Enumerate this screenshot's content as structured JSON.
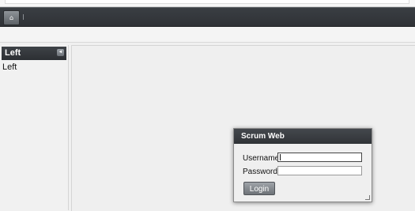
{
  "toolbar": {
    "home_icon": "home-icon",
    "home_glyph": "⌂"
  },
  "left_panel": {
    "header_title": "Left",
    "collapse_icon": "chevron-left-icon",
    "collapse_glyph": "◂",
    "body_text": "Left"
  },
  "login_dialog": {
    "title": "Scrum Web",
    "username_label": "Username",
    "username_value": "",
    "password_label": "Password",
    "password_value": "",
    "login_button_label": "Login"
  }
}
